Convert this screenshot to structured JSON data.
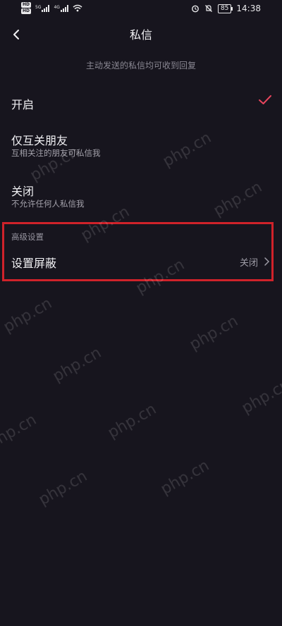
{
  "status_bar": {
    "hd_badges": [
      "HD",
      "HD"
    ],
    "signal_labels": [
      "5G",
      "4G"
    ],
    "battery": "85",
    "time": "14:38"
  },
  "nav": {
    "title": "私信"
  },
  "subtitle": "主动发送的私信均可收到回复",
  "options": [
    {
      "label": "开启",
      "desc": "",
      "selected": true
    },
    {
      "label": "仅互关朋友",
      "desc": "互相关注的朋友可私信我",
      "selected": false
    },
    {
      "label": "关闭",
      "desc": "不允许任何人私信我",
      "selected": false
    }
  ],
  "advanced": {
    "header": "高级设置",
    "block_label": "设置屏蔽",
    "block_value": "关闭"
  },
  "watermark_text": "php.cn",
  "colors": {
    "background": "#17151e",
    "accent_check": "#e8455d",
    "highlight_border": "#d0222a"
  }
}
